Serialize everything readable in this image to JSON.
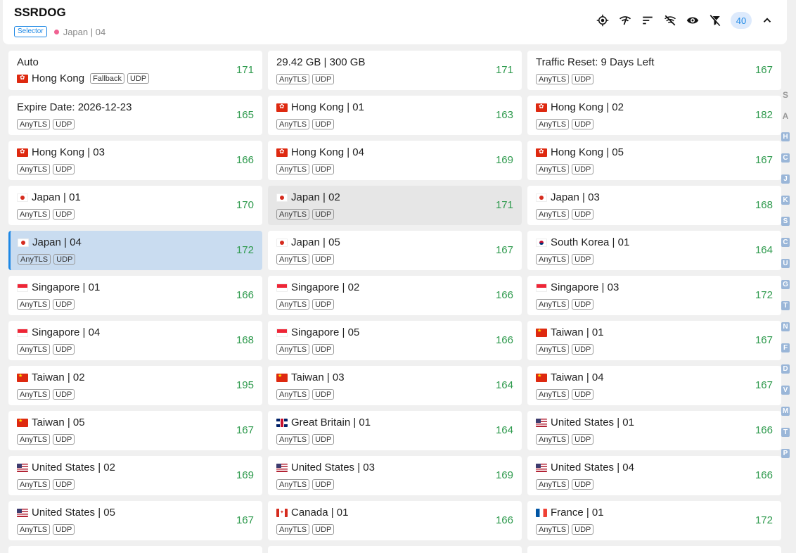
{
  "header": {
    "title": "SSRDOG",
    "type_badge": "Selector",
    "selected_name": "Japan | 04",
    "count": "40"
  },
  "toolbar_icons": [
    "locate-icon",
    "network-check-icon",
    "sort-icon",
    "wifi-off-icon",
    "eye-icon",
    "filter-off-icon",
    "chevron-up-icon"
  ],
  "colors": {
    "latency_green": "#2e9a4d",
    "accent_blue": "#1e88e5",
    "selected_bg": "#c9dcf0"
  },
  "proxies": [
    {
      "name": "Auto",
      "flag": "",
      "sub_flag": "hk",
      "sub_name": "Hong Kong",
      "chips": [
        "Fallback",
        "UDP"
      ],
      "latency": "171"
    },
    {
      "name": "29.42 GB | 300 GB",
      "flag": "",
      "chips": [
        "AnyTLS",
        "UDP"
      ],
      "latency": "171"
    },
    {
      "name": "Traffic Reset: 9 Days Left",
      "flag": "",
      "chips": [
        "AnyTLS",
        "UDP"
      ],
      "latency": "167"
    },
    {
      "name": "Expire Date: 2026-12-23",
      "flag": "",
      "chips": [
        "AnyTLS",
        "UDP"
      ],
      "latency": "165"
    },
    {
      "name": "Hong Kong | 01",
      "flag": "hk",
      "chips": [
        "AnyTLS",
        "UDP"
      ],
      "latency": "163"
    },
    {
      "name": "Hong Kong | 02",
      "flag": "hk",
      "chips": [
        "AnyTLS",
        "UDP"
      ],
      "latency": "182"
    },
    {
      "name": "Hong Kong | 03",
      "flag": "hk",
      "chips": [
        "AnyTLS",
        "UDP"
      ],
      "latency": "166"
    },
    {
      "name": "Hong Kong | 04",
      "flag": "hk",
      "chips": [
        "AnyTLS",
        "UDP"
      ],
      "latency": "169"
    },
    {
      "name": "Hong Kong | 05",
      "flag": "hk",
      "chips": [
        "AnyTLS",
        "UDP"
      ],
      "latency": "167"
    },
    {
      "name": "Japan | 01",
      "flag": "jp",
      "chips": [
        "AnyTLS",
        "UDP"
      ],
      "latency": "170"
    },
    {
      "name": "Japan | 02",
      "flag": "jp",
      "chips": [
        "AnyTLS",
        "UDP"
      ],
      "latency": "171",
      "state": "hover"
    },
    {
      "name": "Japan | 03",
      "flag": "jp",
      "chips": [
        "AnyTLS",
        "UDP"
      ],
      "latency": "168"
    },
    {
      "name": "Japan | 04",
      "flag": "jp",
      "chips": [
        "AnyTLS",
        "UDP"
      ],
      "latency": "172",
      "state": "selected"
    },
    {
      "name": "Japan | 05",
      "flag": "jp",
      "chips": [
        "AnyTLS",
        "UDP"
      ],
      "latency": "167"
    },
    {
      "name": "South Korea | 01",
      "flag": "kr",
      "chips": [
        "AnyTLS",
        "UDP"
      ],
      "latency": "164"
    },
    {
      "name": "Singapore | 01",
      "flag": "sg",
      "chips": [
        "AnyTLS",
        "UDP"
      ],
      "latency": "166"
    },
    {
      "name": "Singapore | 02",
      "flag": "sg",
      "chips": [
        "AnyTLS",
        "UDP"
      ],
      "latency": "166"
    },
    {
      "name": "Singapore | 03",
      "flag": "sg",
      "chips": [
        "AnyTLS",
        "UDP"
      ],
      "latency": "172"
    },
    {
      "name": "Singapore | 04",
      "flag": "sg",
      "chips": [
        "AnyTLS",
        "UDP"
      ],
      "latency": "168"
    },
    {
      "name": "Singapore | 05",
      "flag": "sg",
      "chips": [
        "AnyTLS",
        "UDP"
      ],
      "latency": "166"
    },
    {
      "name": "Taiwan | 01",
      "flag": "tw",
      "chips": [
        "AnyTLS",
        "UDP"
      ],
      "latency": "167"
    },
    {
      "name": "Taiwan | 02",
      "flag": "tw",
      "chips": [
        "AnyTLS",
        "UDP"
      ],
      "latency": "195"
    },
    {
      "name": "Taiwan | 03",
      "flag": "tw",
      "chips": [
        "AnyTLS",
        "UDP"
      ],
      "latency": "164"
    },
    {
      "name": "Taiwan | 04",
      "flag": "tw",
      "chips": [
        "AnyTLS",
        "UDP"
      ],
      "latency": "167"
    },
    {
      "name": "Taiwan | 05",
      "flag": "tw",
      "chips": [
        "AnyTLS",
        "UDP"
      ],
      "latency": "167"
    },
    {
      "name": "Great Britain | 01",
      "flag": "gb",
      "chips": [
        "AnyTLS",
        "UDP"
      ],
      "latency": "164"
    },
    {
      "name": "United States | 01",
      "flag": "us",
      "chips": [
        "AnyTLS",
        "UDP"
      ],
      "latency": "166"
    },
    {
      "name": "United States | 02",
      "flag": "us",
      "chips": [
        "AnyTLS",
        "UDP"
      ],
      "latency": "169"
    },
    {
      "name": "United States | 03",
      "flag": "us",
      "chips": [
        "AnyTLS",
        "UDP"
      ],
      "latency": "169"
    },
    {
      "name": "United States | 04",
      "flag": "us",
      "chips": [
        "AnyTLS",
        "UDP"
      ],
      "latency": "166"
    },
    {
      "name": "United States | 05",
      "flag": "us",
      "chips": [
        "AnyTLS",
        "UDP"
      ],
      "latency": "167"
    },
    {
      "name": "Canada | 01",
      "flag": "ca",
      "chips": [
        "AnyTLS",
        "UDP"
      ],
      "latency": "166"
    },
    {
      "name": "France | 01",
      "flag": "fr",
      "chips": [
        "AnyTLS",
        "UDP"
      ],
      "latency": "172"
    }
  ],
  "alphabet_index": [
    {
      "letter": "S",
      "plain": true
    },
    {
      "letter": "A",
      "plain": true
    },
    {
      "letter": "H"
    },
    {
      "letter": "C"
    },
    {
      "letter": "J"
    },
    {
      "letter": "K"
    },
    {
      "letter": "S"
    },
    {
      "letter": "C"
    },
    {
      "letter": "U"
    },
    {
      "letter": "G"
    },
    {
      "letter": "T"
    },
    {
      "letter": "N"
    },
    {
      "letter": "F"
    },
    {
      "letter": "D"
    },
    {
      "letter": "V"
    },
    {
      "letter": "M"
    },
    {
      "letter": "T"
    },
    {
      "letter": "P"
    }
  ]
}
